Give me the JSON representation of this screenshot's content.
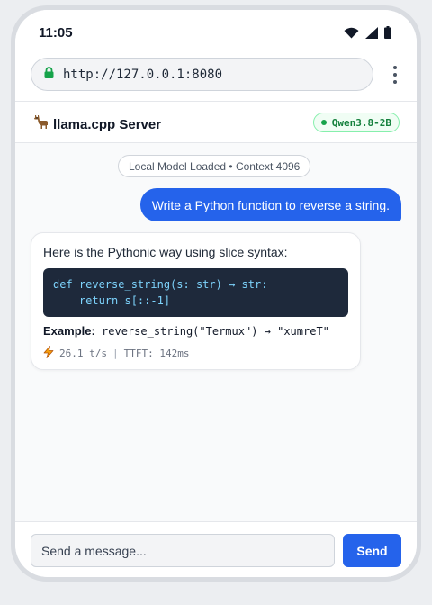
{
  "status_bar": {
    "time": "11:05",
    "icons": [
      "wifi-icon",
      "cell-signal-icon",
      "battery-icon"
    ]
  },
  "browser": {
    "url": "http://127.0.0.1:8080",
    "lock_icon": "lock-icon",
    "menu_icon": "more-vertical-icon"
  },
  "app": {
    "logo_icon": "llama-icon",
    "title": "llama.cpp Server",
    "model_badge": "Qwen3.8-2B"
  },
  "chat": {
    "system_notice": "Local Model Loaded • Context 4096",
    "user_message": "Write a Python function to reverse a string.",
    "assistant": {
      "intro": "Here is the Pythonic way using slice syntax:",
      "code": "def reverse_string(s: str) → str:\n    return s[::-1]",
      "example_label": "Example:",
      "example_code": " reverse_string(\"Termux\") → \"xumreT\"",
      "stats_icon": "lightning-icon",
      "speed": "26.1 t/s",
      "separator": "|",
      "ttft": "TTFT: 142ms"
    }
  },
  "composer": {
    "placeholder": "Send a message...",
    "send_label": "Send"
  },
  "colors": {
    "accent": "#2563eb",
    "badge_green": "#15803d",
    "code_bg": "#1e293b",
    "code_text": "#7dd3fc",
    "lightning": "#f59e0b"
  }
}
